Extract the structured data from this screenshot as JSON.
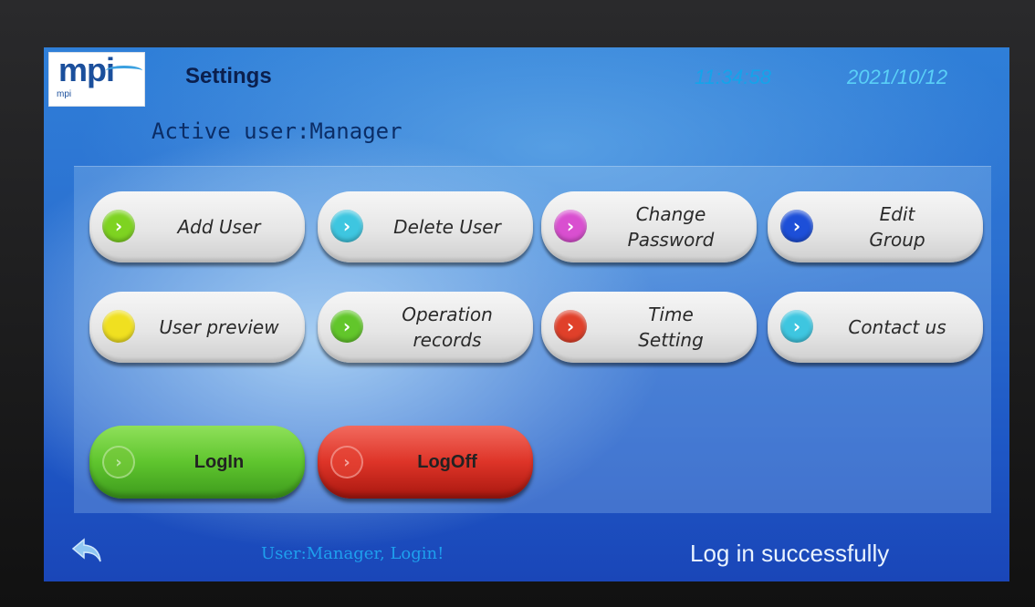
{
  "header": {
    "logo_text": "mpi",
    "logo_subtext": "mpi",
    "title": "Settings",
    "time": "11:34:58",
    "date": "2021/10/12",
    "active_user": "Active user:Manager"
  },
  "buttons": [
    {
      "label": "Add User",
      "orb_color": "#7ed321"
    },
    {
      "label": "Delete User",
      "orb_color": "#3ec6e0"
    },
    {
      "label": "Change\nPassword",
      "orb_color": "#d94fd0"
    },
    {
      "label": "Edit\nGroup",
      "orb_color": "#1d4fd8"
    },
    {
      "label": "User preview",
      "orb_color": "#f0e020"
    },
    {
      "label": "Operation\nrecords",
      "orb_color": "#62c62b"
    },
    {
      "label": "Time\nSetting",
      "orb_color": "#e0402a"
    },
    {
      "label": "Contact us",
      "orb_color": "#3ec6e0"
    }
  ],
  "actions": {
    "login_label": "LogIn",
    "logoff_label": "LogOff"
  },
  "footer": {
    "back_icon": "back-arrow-icon",
    "status_message": "User:Manager, Login!",
    "result": "Log in successfully"
  }
}
